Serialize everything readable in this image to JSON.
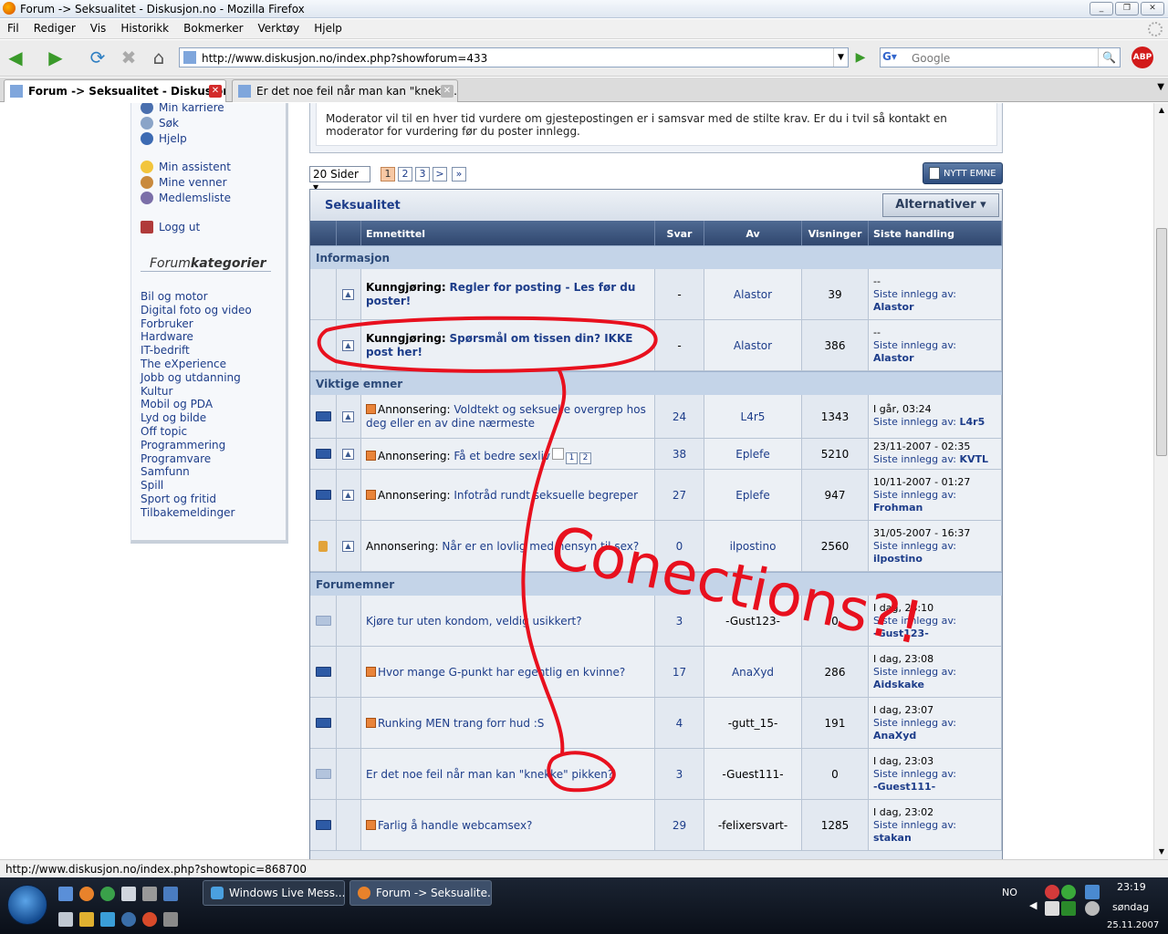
{
  "window": {
    "title": "Forum -> Seksualitet - Diskusjon.no - Mozilla Firefox"
  },
  "menu": [
    "Fil",
    "Rediger",
    "Vis",
    "Historikk",
    "Bokmerker",
    "Verktøy",
    "Hjelp"
  ],
  "nav": {
    "url": "http://www.diskusjon.no/index.php?showforum=433",
    "search_placeholder": "Google",
    "abp": "ABP"
  },
  "tabs": [
    {
      "label": "Forum -> Seksualitet - Diskusjon....",
      "active": true
    },
    {
      "label": "Er det noe feil når man kan \"knekke...",
      "active": false
    }
  ],
  "sidebar": {
    "links_top": [
      "Min karriere",
      "Søk",
      "Hjelp"
    ],
    "links_mid": [
      "Min assistent",
      "Mine venner",
      "Medlemsliste"
    ],
    "logout": "Logg ut",
    "cat_head_a": "Forum",
    "cat_head_b": "kategorier",
    "categories": [
      "Bil og motor",
      "Digital foto og video",
      "Forbruker",
      "Hardware",
      "IT-bedrift",
      "The eXperience",
      "Jobb og utdanning",
      "Kultur",
      "Mobil og PDA",
      "Lyd og bilde",
      "Off topic",
      "Programmering",
      "Programvare",
      "Samfunn",
      "Spill",
      "Sport og fritid",
      "Tilbakemeldinger"
    ]
  },
  "moderator_text": "Moderator vil til en hver tid vurdere om gjestepostingen er i samsvar med de stilte krav. Er du i tvil så kontakt en moderator for vurdering før du poster innlegg.",
  "paging": {
    "select": "20 Sider",
    "pages": [
      "1",
      "2",
      "3",
      ">",
      "»"
    ],
    "current": "1"
  },
  "new_topic": "NYTT EMNE",
  "forum": {
    "title": "Seksualitet",
    "options": "Alternativer ▾",
    "columns": [
      "Emnetittel",
      "Svar",
      "Av",
      "Visninger",
      "Siste handling"
    ],
    "sections": {
      "info": "Informasjon",
      "important": "Viktige emner",
      "topics": "Forumemner"
    },
    "announcements": [
      {
        "prefix": "Kunngjøring:",
        "title": "Regler for posting - Les før du poster!",
        "replies": "-",
        "author": "Alastor",
        "views": "39",
        "last_time": "--",
        "last_label": "Siste innlegg av:",
        "last_user": "Alastor"
      },
      {
        "prefix": "Kunngjøring:",
        "title": "Spørsmål om tissen din? IKKE post her!",
        "replies": "-",
        "author": "Alastor",
        "views": "386",
        "last_time": "--",
        "last_label": "Siste innlegg av:",
        "last_user": "Alastor"
      }
    ],
    "pinned": [
      {
        "prefix": "Annonsering:",
        "title": "Voldtekt og seksuelle overgrep hos deg eller en av dine nærmeste",
        "replies": "24",
        "author": "L4r5",
        "views": "1343",
        "last_time": "I går, 03:24",
        "last_label": "Siste innlegg av:",
        "last_user": "L4r5",
        "icon": "folder",
        "flag": true
      },
      {
        "prefix": "Annonsering:",
        "title": "Få et bedre sexliv",
        "replies": "38",
        "author": "Eplefe",
        "views": "5210",
        "last_time": "23/11-2007 - 02:35",
        "last_label": "Siste innlegg av:",
        "last_user": "KVTL",
        "icon": "folder",
        "flag": true,
        "mini_pages": [
          "1",
          "2"
        ]
      },
      {
        "prefix": "Annonsering:",
        "title": "Infotråd rundt seksuelle begreper",
        "replies": "27",
        "author": "Eplefe",
        "views": "947",
        "last_time": "10/11-2007 - 01:27",
        "last_label": "Siste innlegg av:",
        "last_user": "Frohman",
        "icon": "folder",
        "flag": true
      },
      {
        "prefix": "Annonsering:",
        "title": "Når er en lovlig med hensyn til sex?",
        "replies": "0",
        "author": "ilpostino",
        "views": "2560",
        "last_time": "31/05-2007 - 16:37",
        "last_label": "Siste innlegg av:",
        "last_user": "ilpostino",
        "icon": "lock",
        "flag": false
      }
    ],
    "topics": [
      {
        "title": "Kjøre tur uten kondom, veldig usikkert?",
        "replies": "3",
        "author": "-Gust123-",
        "views": "0",
        "last_time": "I dag, 23:10",
        "last_label": "Siste innlegg av:",
        "last_user": "-Gust123-",
        "icon": "folder-light",
        "flag": false
      },
      {
        "title": "Hvor mange G-punkt har egentlig en kvinne?",
        "replies": "17",
        "author": "AnaXyd",
        "views": "286",
        "last_time": "I dag, 23:08",
        "last_label": "Siste innlegg av:",
        "last_user": "Aidskake",
        "icon": "folder",
        "flag": true
      },
      {
        "title": "Runking MEN trang forr hud :S",
        "replies": "4",
        "author": "-gutt_15-",
        "views": "191",
        "last_time": "I dag, 23:07",
        "last_label": "Siste innlegg av:",
        "last_user": "AnaXyd",
        "icon": "folder",
        "flag": true
      },
      {
        "title": "Er det noe feil når man kan \"knekke\" pikken?",
        "replies": "3",
        "author": "-Guest111-",
        "views": "0",
        "last_time": "I dag, 23:03",
        "last_label": "Siste innlegg av:",
        "last_user": "-Guest111-",
        "icon": "folder-light",
        "flag": false
      },
      {
        "title": "Farlig å handle webcamsex?",
        "replies": "29",
        "author": "-felixersvart-",
        "views": "1285",
        "last_time": "I dag, 23:02",
        "last_label": "Siste innlegg av:",
        "last_user": "stakan",
        "icon": "folder",
        "flag": true
      }
    ]
  },
  "status_url": "http://www.diskusjon.no/index.php?showtopic=868700",
  "annotation": "Conections?!",
  "taskbar": {
    "tasks": [
      "Windows Live Mess...",
      "Forum -> Seksualite..."
    ],
    "lang": "NO",
    "time": "23:19",
    "day": "søndag",
    "date": "25.11.2007"
  }
}
